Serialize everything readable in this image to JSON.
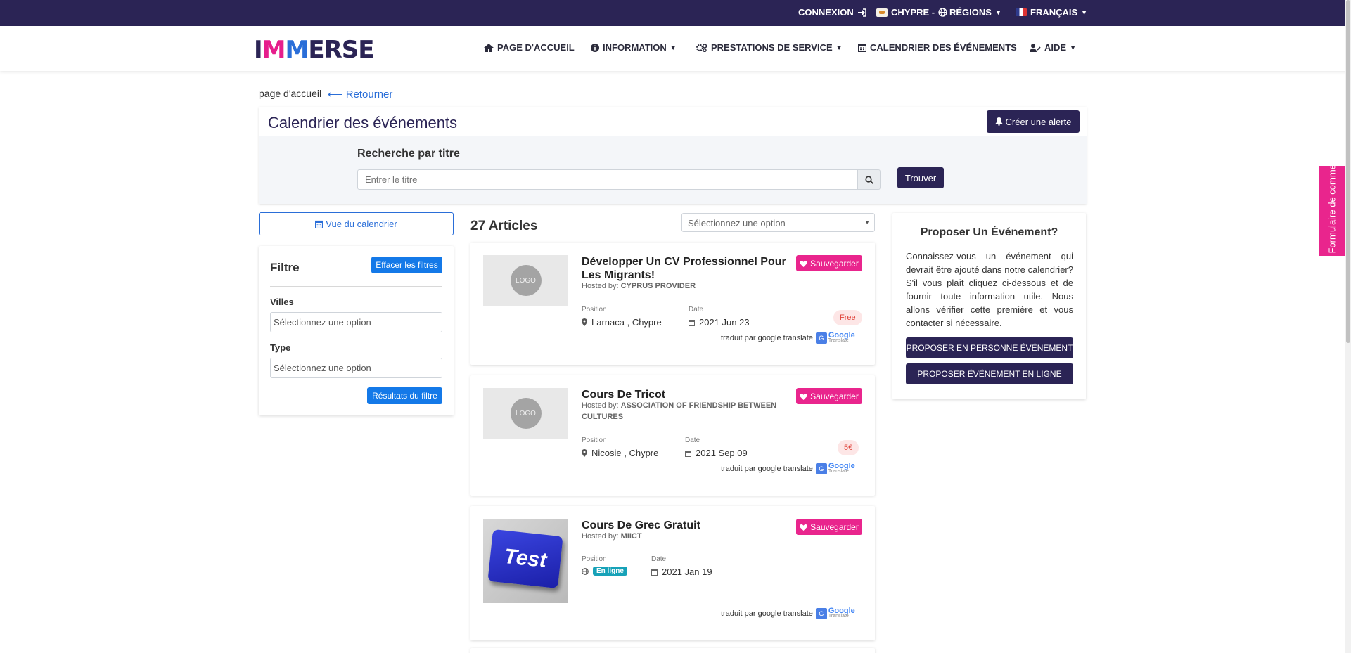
{
  "topbar": {
    "login": "CONNEXION",
    "country": "CHYPRE -",
    "regions": "RÉGIONS",
    "language": "FRANÇAIS"
  },
  "header": {
    "logo": {
      "part1": "I",
      "m1": "M",
      "m2": "M",
      "part2": "ERSE"
    },
    "nav": [
      {
        "label": "PAGE D'ACCUEIL",
        "icon": "home-icon"
      },
      {
        "label": "INFORMATION",
        "icon": "info-icon"
      },
      {
        "label": "PRESTATIONS DE SERVICE",
        "icon": "gears-icon"
      },
      {
        "label": "CALENDRIER DES ÉVÉNEMENTS",
        "icon": "calendar-icon"
      },
      {
        "label": "AIDE",
        "icon": "user-edit-icon"
      }
    ]
  },
  "breadcrumb": {
    "home": "page d'accueil",
    "back": "Retourner"
  },
  "calendar": {
    "title": "Calendrier des événements",
    "alert_button": "Créer une alerte",
    "search_label": "Recherche par titre",
    "search_placeholder": "Entrer le titre",
    "find_button": "Trouver"
  },
  "sidebar": {
    "calendar_view_button": "Vue du calendrier",
    "filter_title": "Filtre",
    "clear_button": "Effacer les filtres",
    "cities_label": "Villes",
    "cities_placeholder": "Sélectionnez une option",
    "type_label": "Type",
    "type_placeholder": "Sélectionnez une option",
    "results_button": "Résultats du filtre"
  },
  "list": {
    "count": "27 Articles",
    "sort_placeholder": "Sélectionnez une option",
    "position_label": "Position",
    "date_label": "Date",
    "save_button": "Sauvegarder",
    "translated_by": "traduit par google translate",
    "google_word": "Google",
    "translate_word": "Translate",
    "logo_placeholder": "LOGO",
    "events": [
      {
        "title": "Développer Un CV Professionnel Pour Les Migrants!",
        "hosted_prefix": "Hosted by:",
        "host": "CYPRUS PROVIDER",
        "location": "Larnaca , Chypre",
        "date": "2021 Jun 23",
        "price": "Free"
      },
      {
        "title": "Cours De Tricot",
        "hosted_prefix": "Hosted by:",
        "host": "ASSOCIATION OF FRIENDSHIP BETWEEN CULTURES",
        "location": "Nicosie , Chypre",
        "date": "2021 Sep 09",
        "price": "5€"
      },
      {
        "title": "Cours De Grec Gratuit",
        "hosted_prefix": "Hosted by:",
        "host": "MIICT",
        "location": "En ligne",
        "date": "2021 Jan 19",
        "image_text": "Test"
      }
    ]
  },
  "propose": {
    "title": "Proposer Un Événement?",
    "text": "Connaissez-vous un événement qui devrait être ajouté dans notre calendrier? S'il vous plaît cliquez ci-dessous et de fournir toute information utile. Nous allons vérifier cette première et vous contacter si nécessaire.",
    "in_person_button": "PROPOSER EN PERSONNE ÉVÉNEMENT",
    "online_button": "PROPOSER ÉVÉNEMENT EN LIGNE"
  },
  "feedback_tab": "Formulaire de commentaires",
  "colors": {
    "primary_dark": "#2b2455",
    "accent_pink": "#e9258d",
    "link_blue": "#2a6ed8",
    "button_blue": "#1479e8"
  }
}
